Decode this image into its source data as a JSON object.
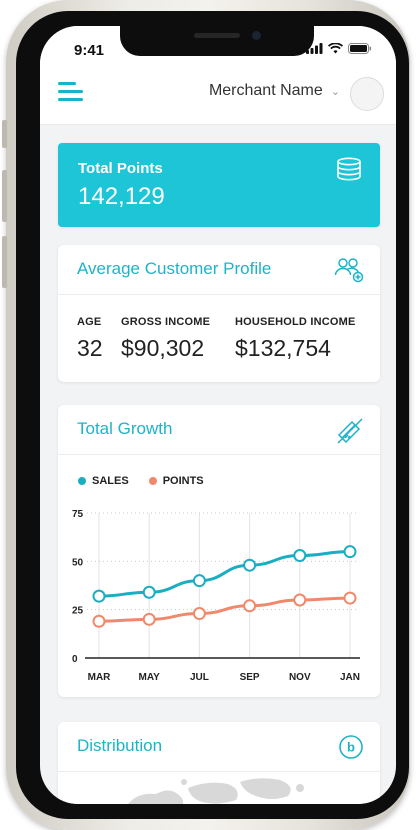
{
  "status_bar": {
    "time": "9:41"
  },
  "header": {
    "merchant_name": "Merchant Name"
  },
  "total_points": {
    "label": "Total Points",
    "value": "142,129"
  },
  "profile": {
    "title": "Average Customer Profile",
    "stats": [
      {
        "label": "AGE",
        "value": "32"
      },
      {
        "label": "GROSS INCOME",
        "value": "$90,302"
      },
      {
        "label": "HOUSEHOLD INCOME",
        "value": "$132,754"
      }
    ]
  },
  "growth": {
    "title": "Total Growth"
  },
  "distribution": {
    "title": "Distribution"
  },
  "colors": {
    "accent": "#1ec5d6",
    "sales": "#1aaec2",
    "points": "#f0896b"
  },
  "icons": [
    "hamburger-menu-icon",
    "chevron-down-icon",
    "coins-icon",
    "users-add-icon",
    "card-tag-icon",
    "currency-b-icon"
  ],
  "chart_data": {
    "type": "line",
    "categories": [
      "MAR",
      "MAY",
      "JUL",
      "SEP",
      "NOV",
      "JAN"
    ],
    "series": [
      {
        "name": "SALES",
        "values": [
          32,
          34,
          40,
          48,
          53,
          55
        ]
      },
      {
        "name": "POINTS",
        "values": [
          19,
          20,
          23,
          27,
          30,
          31
        ]
      }
    ],
    "yticks": [
      0,
      25,
      50,
      75
    ],
    "ylim": [
      0,
      75
    ],
    "legend": "top-left",
    "grid": true
  }
}
